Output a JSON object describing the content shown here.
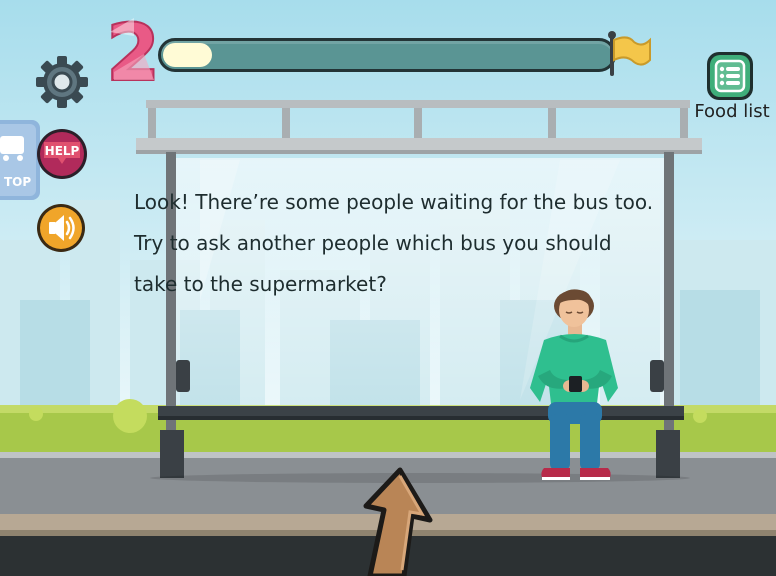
{
  "level": {
    "number": "2"
  },
  "progress": {
    "fraction": 0.11
  },
  "food_list": {
    "label": "Food list",
    "icon": "list-icon"
  },
  "controls": {
    "settings_icon": "gear-icon",
    "help_label": "HELP",
    "sound_icon": "speaker-icon"
  },
  "bus_stop_sign": {
    "text": "TOP"
  },
  "dialog": {
    "line1": "Look! There’re some people waiting for the bus too.",
    "line2": "Try to ask another people which bus you should",
    "line3": "take to the supermarket?"
  },
  "colors": {
    "progress_track": "#5a9594",
    "progress_fill": "#fffbd6",
    "flag": "#f4c64a",
    "food_list_button": "#3fae7a",
    "help_button": "#b12a5b",
    "sound_button": "#f0a52a",
    "person_shirt": "#2fbf8f",
    "person_pants": "#2c79a8",
    "arrow": "#b98556"
  }
}
